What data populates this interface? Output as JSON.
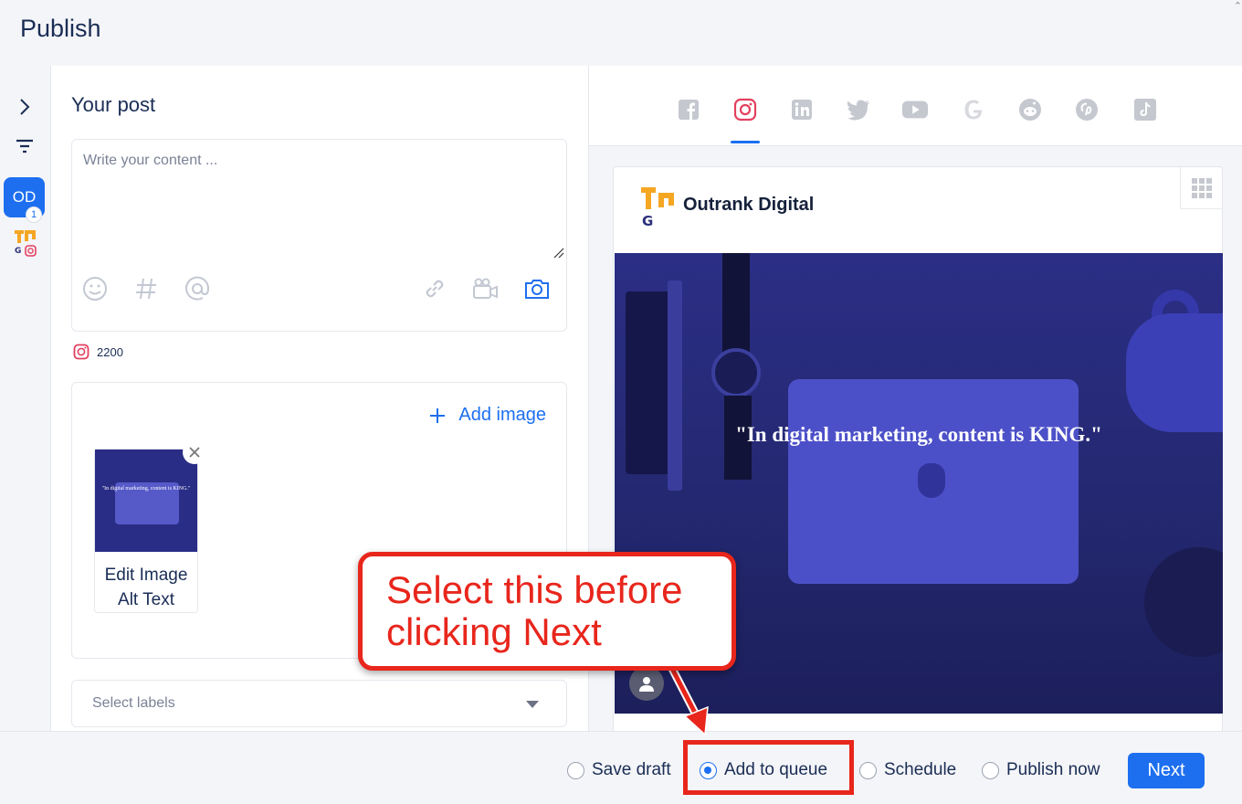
{
  "header": {
    "title": "Publish"
  },
  "rail": {
    "account_initials": "OD",
    "account_badge": "1"
  },
  "composer": {
    "heading": "Your post",
    "placeholder": "Write your content ...",
    "char_count": "2200",
    "add_image_label": "Add image",
    "thumbnail_quote": "\"In digital marketing, content is KING.\"",
    "edit_alt_label": "Edit Image Alt Text",
    "labels_placeholder": "Select labels"
  },
  "preview": {
    "networks": [
      "facebook-icon",
      "instagram-icon",
      "linkedin-icon",
      "twitter-icon",
      "youtube-icon",
      "google-icon",
      "reddit-icon",
      "pinterest-icon",
      "tiktok-icon"
    ],
    "active_network": "instagram",
    "account_name": "Outrank Digital",
    "image_quote": "\"In digital marketing, content is KING.\""
  },
  "footer": {
    "options": [
      {
        "label": "Save draft",
        "selected": false
      },
      {
        "label": "Add to queue",
        "selected": true
      },
      {
        "label": "Schedule",
        "selected": false
      },
      {
        "label": "Publish now",
        "selected": false
      }
    ],
    "next_label": "Next"
  },
  "annotation": {
    "callout_text": "Select this before clicking Next"
  },
  "colors": {
    "accent": "#1d6ff0",
    "annotation": "#e8261c",
    "instagram": "#e4405f"
  }
}
